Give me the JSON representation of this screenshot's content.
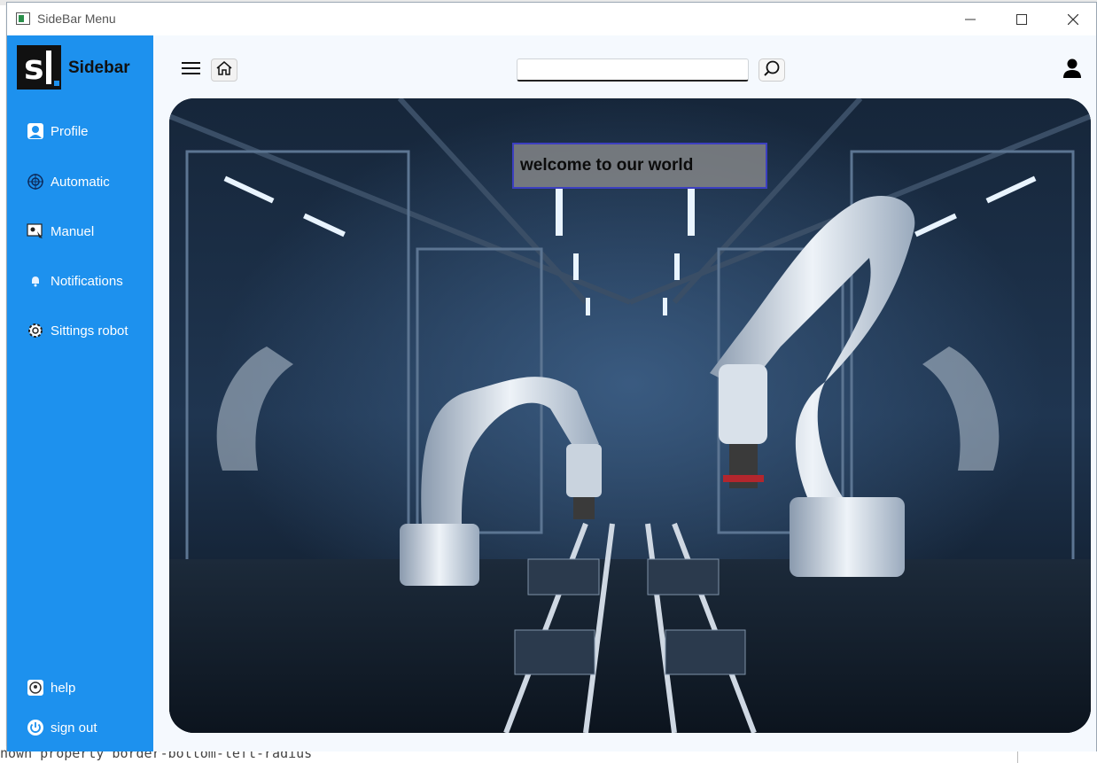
{
  "window": {
    "title": "SideBar Menu",
    "controls": [
      "—",
      "☐",
      "✕"
    ]
  },
  "background": {
    "bottom_text": "nown property border-bottom-left-radius"
  },
  "sidebar": {
    "brand": "Sidebar",
    "items": [
      {
        "label": "Profile",
        "icon": "profile-icon"
      },
      {
        "label": "Automatic",
        "icon": "automatic-icon"
      },
      {
        "label": "Manuel",
        "icon": "manual-icon"
      },
      {
        "label": "Notifications",
        "icon": "bell-icon"
      },
      {
        "label": "Sittings robot",
        "icon": "gear-icon"
      }
    ],
    "footer": [
      {
        "label": "help",
        "icon": "help-icon"
      },
      {
        "label": "sign out",
        "icon": "power-icon"
      }
    ]
  },
  "header": {
    "search": {
      "value": "",
      "placeholder": ""
    },
    "icons": [
      "menu-icon",
      "home-icon",
      "search-icon",
      "user-icon"
    ]
  },
  "hero": {
    "welcome_text": "welcome to our world"
  },
  "colors": {
    "sidebar": "#1d91ee",
    "main_bg": "#f5f9fe",
    "welcome_border": "#3c3fc0"
  }
}
